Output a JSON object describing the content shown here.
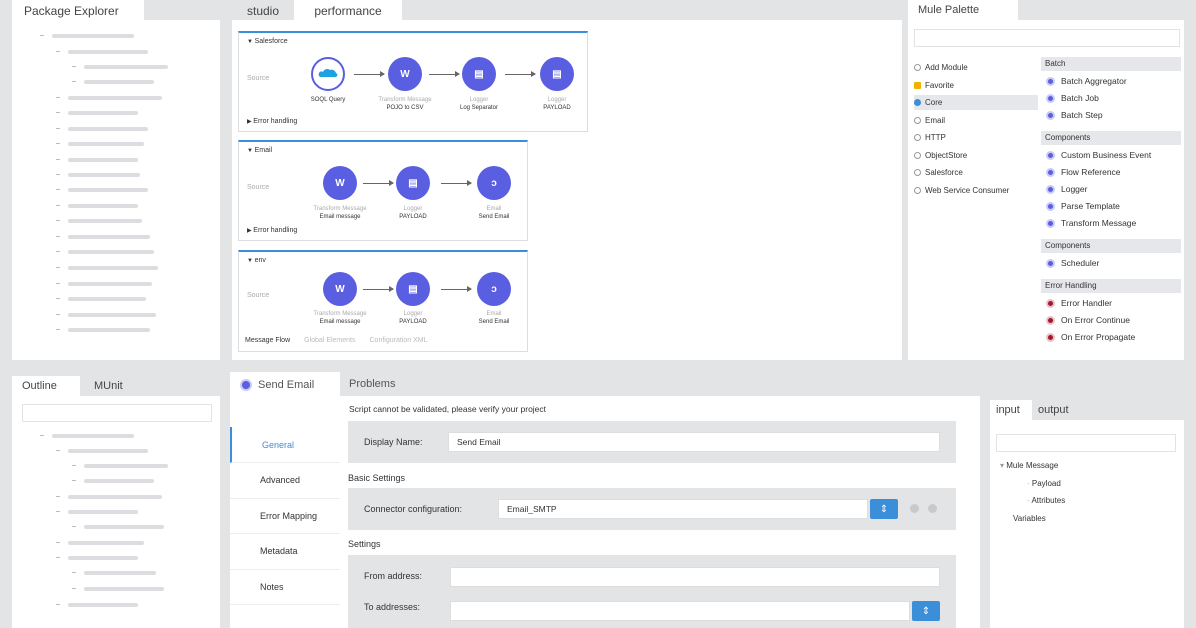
{
  "package_explorer": {
    "title": "Package Explorer"
  },
  "editor": {
    "tabs": [
      "studio",
      "performance"
    ]
  },
  "flows": [
    {
      "name": "Salesforce",
      "source": "Source",
      "error": "Error handling",
      "nodes": [
        {
          "icon": "salesforce-icon",
          "sub": "",
          "label": "SOQL Query"
        },
        {
          "icon": "transform-icon",
          "sub": "Transform Message",
          "label": "POJO to CSV"
        },
        {
          "icon": "logger-icon",
          "sub": "Logger",
          "label": "Log Separator"
        },
        {
          "icon": "logger-icon",
          "sub": "Logger",
          "label": "PAYLOAD"
        }
      ]
    },
    {
      "name": "Email",
      "source": "Source",
      "error": "Error handling",
      "nodes": [
        {
          "icon": "transform-icon",
          "sub": "Transform Message",
          "label": "Email message"
        },
        {
          "icon": "logger-icon",
          "sub": "Logger",
          "label": "PAYLOAD"
        },
        {
          "icon": "email-icon",
          "sub": "Email",
          "label": "Send Email"
        }
      ]
    },
    {
      "name": "env",
      "source": "Source",
      "nodes": [
        {
          "icon": "transform-icon",
          "sub": "Transform Message",
          "label": "Email message"
        },
        {
          "icon": "logger-icon",
          "sub": "Logger",
          "label": "PAYLOAD"
        },
        {
          "icon": "email-icon",
          "sub": "Email",
          "label": "Send Email"
        }
      ]
    }
  ],
  "editor_bottom_tabs": [
    "Message Flow",
    "Global Elements",
    "Configuration XML"
  ],
  "palette": {
    "title": "Mule Palette",
    "modules": [
      "Add Module",
      "Favorite",
      "Core",
      "Email",
      "HTTP",
      "ObjectStore",
      "Salesforce",
      "Web Service Consumer"
    ],
    "categories": [
      {
        "name": "Batch",
        "ops": [
          {
            "label": "Batch Aggregator",
            "color": "#5a5ee0"
          },
          {
            "label": "Batch Job",
            "color": "#5a5ee0"
          },
          {
            "label": "Batch Step",
            "color": "#5a5ee0"
          }
        ]
      },
      {
        "name": "Components",
        "ops": [
          {
            "label": "Custom Business Event",
            "color": "#5a5ee0"
          },
          {
            "label": "Flow Reference",
            "color": "#5a5ee0"
          },
          {
            "label": "Logger",
            "color": "#5a5ee0"
          },
          {
            "label": "Parse Template",
            "color": "#5a5ee0"
          },
          {
            "label": "Transform Message",
            "color": "#5a5ee0"
          }
        ]
      },
      {
        "name": "Components",
        "ops": [
          {
            "label": "Scheduler",
            "color": "#5a5ee0"
          }
        ]
      },
      {
        "name": "Error Handling",
        "ops": [
          {
            "label": "Error Handler",
            "color": "#a31a2e"
          },
          {
            "label": "On Error Continue",
            "color": "#a31a2e"
          },
          {
            "label": "On Error Propagate",
            "color": "#a31a2e"
          }
        ]
      }
    ]
  },
  "outline": {
    "tabs": [
      "Outline",
      "MUnit"
    ]
  },
  "props": {
    "tab": "Send Email",
    "problems_tab": "Problems",
    "warning": "Script cannot be validated, please verify your project",
    "side": [
      "General",
      "Advanced",
      "Error Mapping",
      "Metadata",
      "Notes"
    ],
    "display_name_label": "Display Name:",
    "display_name_value": "Send Email",
    "basic_settings": "Basic Settings",
    "connector_label": "Connector configuration:",
    "connector_value": "Email_SMTP",
    "settings": "Settings",
    "from_label": "From address:",
    "from_value": "",
    "to_label": "To addresses:",
    "to_value": ""
  },
  "io": {
    "tabs": [
      "input",
      "output"
    ],
    "tree": [
      "Mule Message",
      "Payload",
      "Attributes",
      "Variables"
    ]
  }
}
